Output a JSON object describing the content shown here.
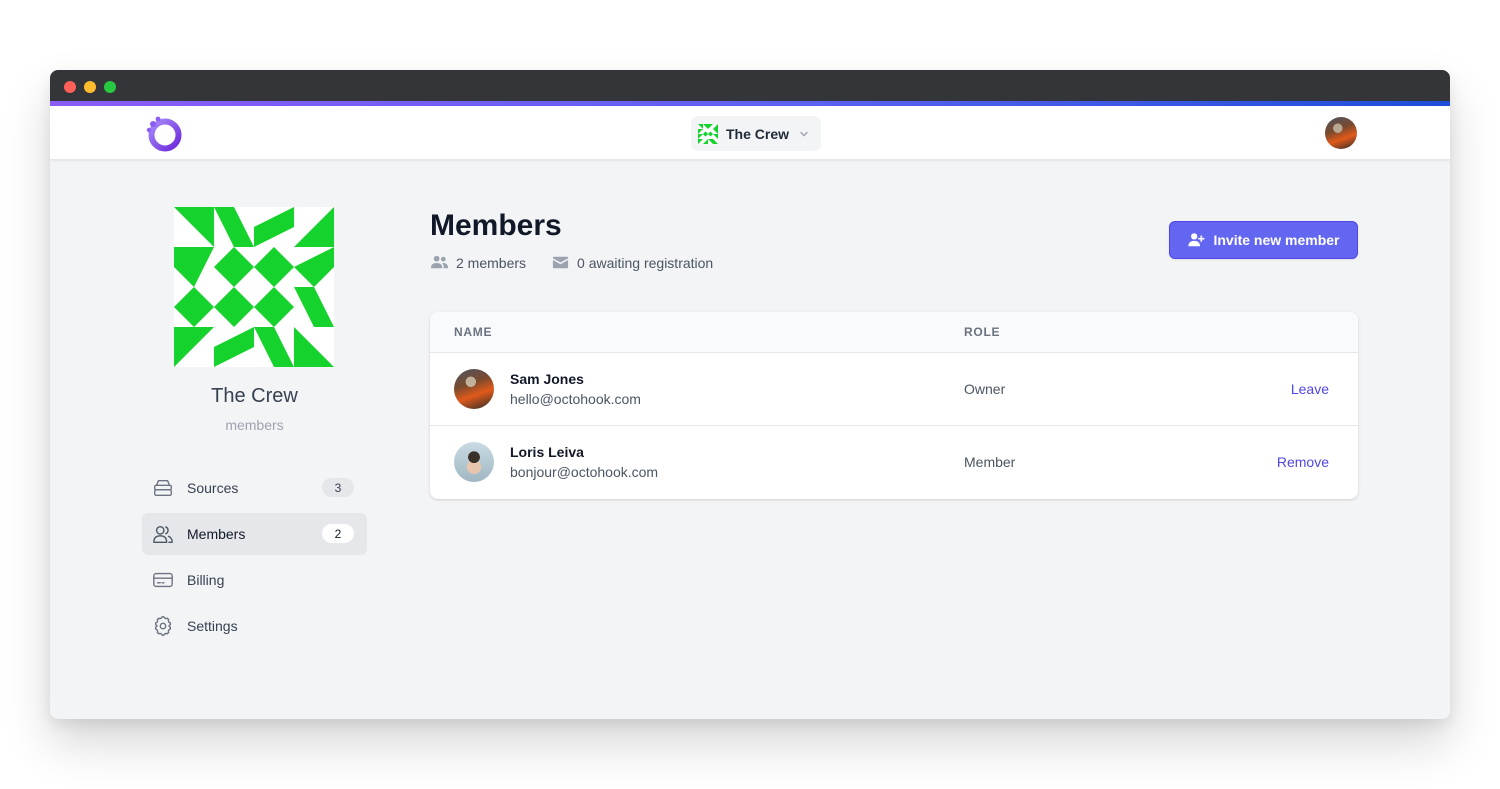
{
  "window": {
    "traffic_lights": [
      "close",
      "minimize",
      "zoom"
    ]
  },
  "header": {
    "team_switcher": {
      "label": "The Crew",
      "icon": "chevron-down-icon"
    },
    "logo": "octohook-logo"
  },
  "team": {
    "name": "The Crew",
    "subtitle": "members",
    "avatar_color": "#16d22c"
  },
  "sidebar": {
    "items": [
      {
        "label": "Sources",
        "icon": "database-icon",
        "badge": "3",
        "active": false
      },
      {
        "label": "Members",
        "icon": "users-icon",
        "badge": "2",
        "active": true
      },
      {
        "label": "Billing",
        "icon": "credit-card-icon",
        "badge": "",
        "active": false
      },
      {
        "label": "Settings",
        "icon": "gear-icon",
        "badge": "",
        "active": false
      }
    ]
  },
  "main": {
    "title": "Members",
    "members_count": "2 members",
    "awaiting": "0 awaiting registration",
    "invite_button": "Invite new member",
    "table": {
      "columns": [
        "NAME",
        "ROLE"
      ],
      "rows": [
        {
          "name": "Sam Jones",
          "email": "hello@octohook.com",
          "role": "Owner",
          "action": "Leave"
        },
        {
          "name": "Loris Leiva",
          "email": "bonjour@octohook.com",
          "role": "Member",
          "action": "Remove"
        }
      ]
    }
  },
  "colors": {
    "accent": "#6366f1",
    "link": "#4f46e5",
    "team_green": "#16d22c",
    "background": "#f3f4f6"
  }
}
